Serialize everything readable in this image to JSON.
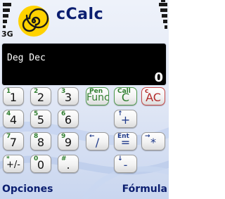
{
  "status": {
    "network": "3G"
  },
  "app": {
    "title": "cCalc"
  },
  "display": {
    "mode": "Deg Dec",
    "value": "0"
  },
  "keys": [
    {
      "id": "key-1",
      "sub": "1",
      "main": "1",
      "style": "normal"
    },
    {
      "id": "key-2",
      "sub": "2",
      "main": "2",
      "style": "normal"
    },
    {
      "id": "key-3",
      "sub": "3",
      "main": "3",
      "style": "normal"
    },
    {
      "id": "key-func",
      "sub": "Pen",
      "main": "Func",
      "style": "green"
    },
    {
      "id": "key-clear",
      "sub": "Call",
      "main": "C",
      "style": "green"
    },
    {
      "id": "key-all-clear",
      "sub": "c",
      "main": "AC",
      "style": "red"
    },
    {
      "id": "key-4",
      "sub": "4",
      "main": "4",
      "style": "normal"
    },
    {
      "id": "key-5",
      "sub": "5",
      "main": "5",
      "style": "normal"
    },
    {
      "id": "key-6",
      "sub": "6",
      "main": "6",
      "style": "normal"
    },
    {
      "id": "key-plus",
      "sub": "↑",
      "main": "+",
      "style": "blue"
    },
    {
      "id": "key-7",
      "sub": "7",
      "main": "7",
      "style": "normal"
    },
    {
      "id": "key-8",
      "sub": "8",
      "main": "8",
      "style": "normal"
    },
    {
      "id": "key-9",
      "sub": "9",
      "main": "9",
      "style": "normal"
    },
    {
      "id": "key-divide",
      "sub": "←",
      "main": "/",
      "style": "blue"
    },
    {
      "id": "key-equals",
      "sub": "Ent",
      "main": "=",
      "style": "blue"
    },
    {
      "id": "key-multiply",
      "sub": "→",
      "main": "*",
      "style": "blue"
    },
    {
      "id": "key-sign",
      "sub": "*",
      "main": "+/-",
      "style": "normal"
    },
    {
      "id": "key-0",
      "sub": "0",
      "main": "0",
      "style": "normal"
    },
    {
      "id": "key-decimal",
      "sub": "#",
      "main": ".",
      "style": "normal"
    },
    {
      "id": "key-minus",
      "sub": "↓",
      "main": "-",
      "style": "blue"
    }
  ],
  "softkeys": {
    "left": "Opciones",
    "right": "Fórmula"
  },
  "colors": {
    "title": "#0b1e70",
    "display_bg": "#000000",
    "green_key": "#2d7d2d",
    "red_key": "#b32b2b",
    "logo": "#ffd200"
  }
}
